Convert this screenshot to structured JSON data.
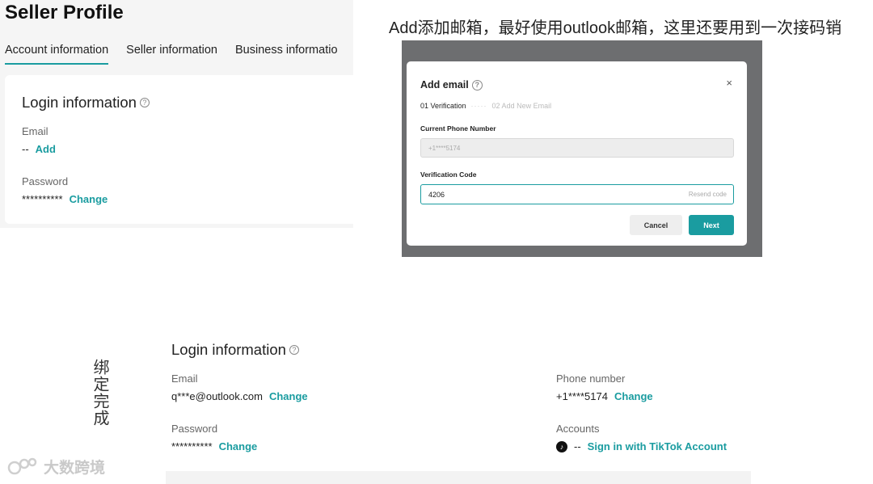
{
  "caption_top": "Add添加邮箱，最好使用outlook邮箱，这里还要用到一次接码销",
  "caption_side": "绑定完成",
  "seller_profile": {
    "title": "Seller Profile",
    "tabs": [
      {
        "label": "Account information",
        "active": true
      },
      {
        "label": "Seller information",
        "active": false
      },
      {
        "label": "Business informatio",
        "active": false
      }
    ],
    "login_title": "Login information",
    "email_label": "Email",
    "email_value": "--",
    "email_action": "Add",
    "password_label": "Password",
    "password_value": "**********",
    "password_action": "Change"
  },
  "modal": {
    "title": "Add email",
    "close": "×",
    "step1": "01 Verification",
    "step_dots": "·····",
    "step2": "02 Add New Email",
    "phone_label": "Current Phone Number",
    "phone_value": "+1****5174",
    "code_label": "Verification Code",
    "code_value": "4206",
    "resend": "Resend code",
    "cancel": "Cancel",
    "next": "Next"
  },
  "bound": {
    "login_title": "Login information",
    "email_label": "Email",
    "email_value": "q***e@outlook.com",
    "email_action": "Change",
    "password_label": "Password",
    "password_value": "**********",
    "password_action": "Change",
    "phone_label": "Phone number",
    "phone_value": "+1****5174",
    "phone_action": "Change",
    "accounts_label": "Accounts",
    "accounts_value": "--",
    "accounts_action": "Sign in with TikTok Account"
  },
  "watermark": "大数跨境",
  "colors": {
    "accent": "#1a9ca0",
    "overlay": "#6d6e70"
  }
}
